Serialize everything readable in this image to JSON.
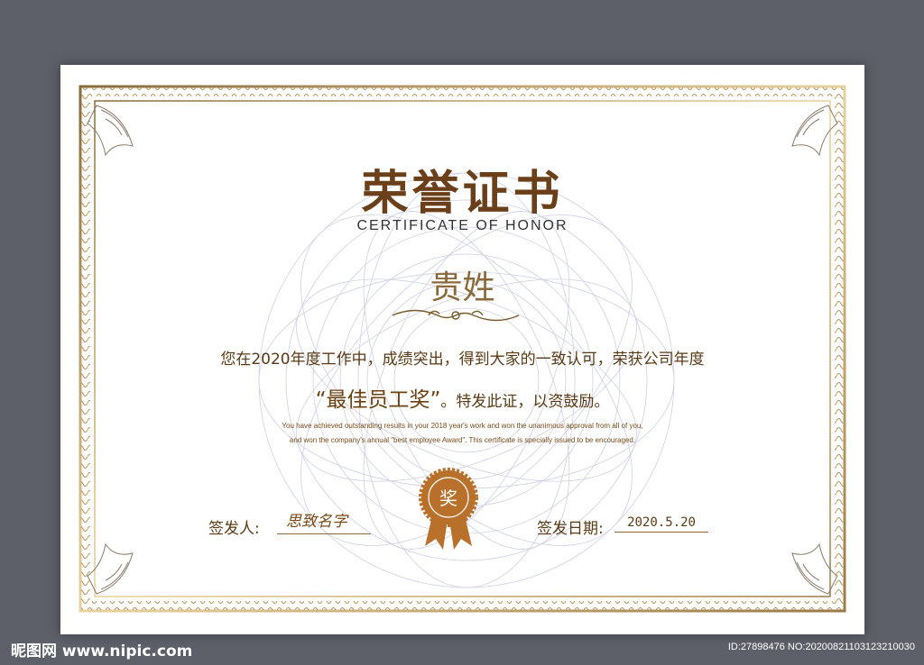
{
  "certificate": {
    "title_cn": "荣誉证书",
    "title_en": "CERTIFICATE OF HONOR",
    "name": "贵姓",
    "body_line1": "您在2020年度工作中，成绩突出，得到大家的一致认可，荣获公司年度",
    "award_name": "“最佳员工奖”",
    "body_line2_rest": "。特发此证，以资鼓励。",
    "english_line1": "You have achieved outstanding results in your 2018 year's work and won the unanimous approval from all of you,",
    "english_line2": "and won the company's annual \"best employee Award\". This certificate is specially issued to be encouraged.",
    "seal_char": "奖",
    "issuer_label": "签发人:",
    "signature": "思致名字",
    "date_label": "签发日期:",
    "date_value": "2020.5.20"
  },
  "footer": {
    "site": "昵图网 www.nipic.com",
    "id_text": "ID:27898476 NO:20200821103123210030"
  },
  "colors": {
    "gold": "#c9a870",
    "brown": "#6b3f1a",
    "seal": "#b8702a",
    "background": "#5d5f69"
  }
}
